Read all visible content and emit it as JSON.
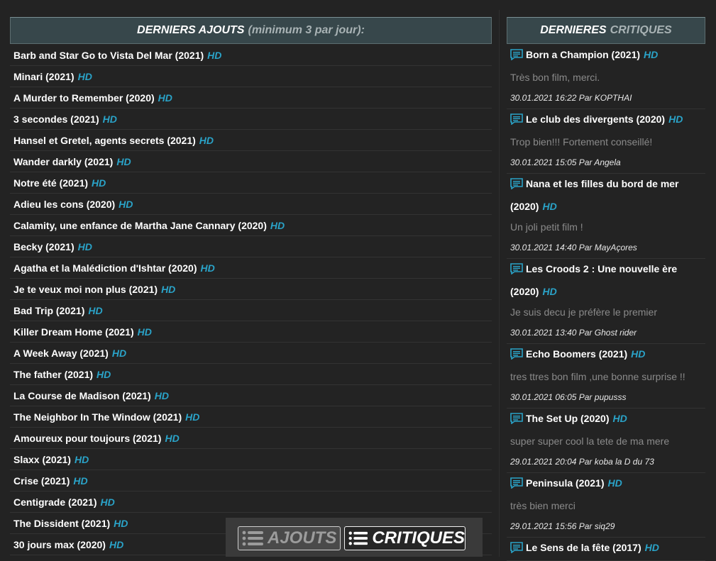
{
  "colors": {
    "accent_hd": "#2aa3c8",
    "header_bg": "#37474b",
    "page_bg": "#232323"
  },
  "left": {
    "header_main": "DERNIERS AJOUTS",
    "header_sub": "(minimum 3 par jour):",
    "movies": [
      {
        "title": "Barb and Star Go to Vista Del Mar (2021)",
        "badge": "HD"
      },
      {
        "title": "Minari (2021)",
        "badge": "HD"
      },
      {
        "title": "A Murder to Remember (2020)",
        "badge": "HD"
      },
      {
        "title": "3 secondes (2021)",
        "badge": "HD"
      },
      {
        "title": "Hansel et Gretel, agents secrets (2021)",
        "badge": "HD"
      },
      {
        "title": "Wander darkly (2021)",
        "badge": "HD"
      },
      {
        "title": "Notre été (2021)",
        "badge": "HD"
      },
      {
        "title": "Adieu les cons (2020)",
        "badge": "HD"
      },
      {
        "title": "Calamity, une enfance de Martha Jane Cannary (2020)",
        "badge": "HD"
      },
      {
        "title": "Becky (2021)",
        "badge": "HD"
      },
      {
        "title": "Agatha et la Malédiction d'Ishtar (2020)",
        "badge": "HD"
      },
      {
        "title": "Je te veux moi non plus (2021)",
        "badge": "HD"
      },
      {
        "title": "Bad Trip (2021)",
        "badge": "HD"
      },
      {
        "title": "Killer Dream Home (2021)",
        "badge": "HD"
      },
      {
        "title": "A Week Away (2021)",
        "badge": "HD"
      },
      {
        "title": "The father (2021)",
        "badge": "HD"
      },
      {
        "title": "La Course de Madison (2021)",
        "badge": "HD"
      },
      {
        "title": "The Neighbor In The Window (2021)",
        "badge": "HD"
      },
      {
        "title": "Amoureux pour toujours (2021)",
        "badge": "HD"
      },
      {
        "title": "Slaxx (2021)",
        "badge": "HD"
      },
      {
        "title": "Crise (2021)",
        "badge": "HD"
      },
      {
        "title": "Centigrade (2021)",
        "badge": "HD"
      },
      {
        "title": "The Dissident (2021)",
        "badge": "HD"
      },
      {
        "title": "30 jours max (2020)",
        "badge": "HD"
      }
    ]
  },
  "right": {
    "header_main": "DERNIERES",
    "header_sub": "CRITIQUES",
    "critiques": [
      {
        "title": "Born a Champion (2021)",
        "badge": "HD",
        "text": "Très bon film, merci.",
        "meta": "30.01.2021 16:22 Par KOPTHAI"
      },
      {
        "title": "Le club des divergents (2020)",
        "badge": "HD",
        "text": "Trop bien!!! Fortement conseillé!",
        "meta": "30.01.2021 15:05 Par Angela"
      },
      {
        "title": "Nana et les filles du bord de mer (2020)",
        "badge": "HD",
        "text": "Un joli petit film !",
        "meta": "30.01.2021 14:40 Par MayAçores"
      },
      {
        "title": "Les Croods 2 : Une nouvelle ère (2020)",
        "badge": "HD",
        "text": "Je suis decu je préfère le premier",
        "meta": "30.01.2021 13:40 Par Ghost rider"
      },
      {
        "title": "Echo Boomers (2021)",
        "badge": "HD",
        "text": "tres ttres bon film ,une bonne surprise !!",
        "meta": "30.01.2021 06:05 Par pupusss"
      },
      {
        "title": "The Set Up (2020)",
        "badge": "HD",
        "text": "super super cool la tete de ma mere",
        "meta": "29.01.2021 20:04 Par koba la D du 73"
      },
      {
        "title": "Peninsula (2021)",
        "badge": "HD",
        "text": "très bien merci",
        "meta": "29.01.2021 15:56 Par siq29"
      },
      {
        "title": "Le Sens de la fête (2017)",
        "badge": "HD",
        "text": "",
        "meta": ""
      }
    ]
  },
  "tabs": {
    "ajouts_label": "AJOUTS",
    "critiques_label": "CRITIQUES"
  }
}
